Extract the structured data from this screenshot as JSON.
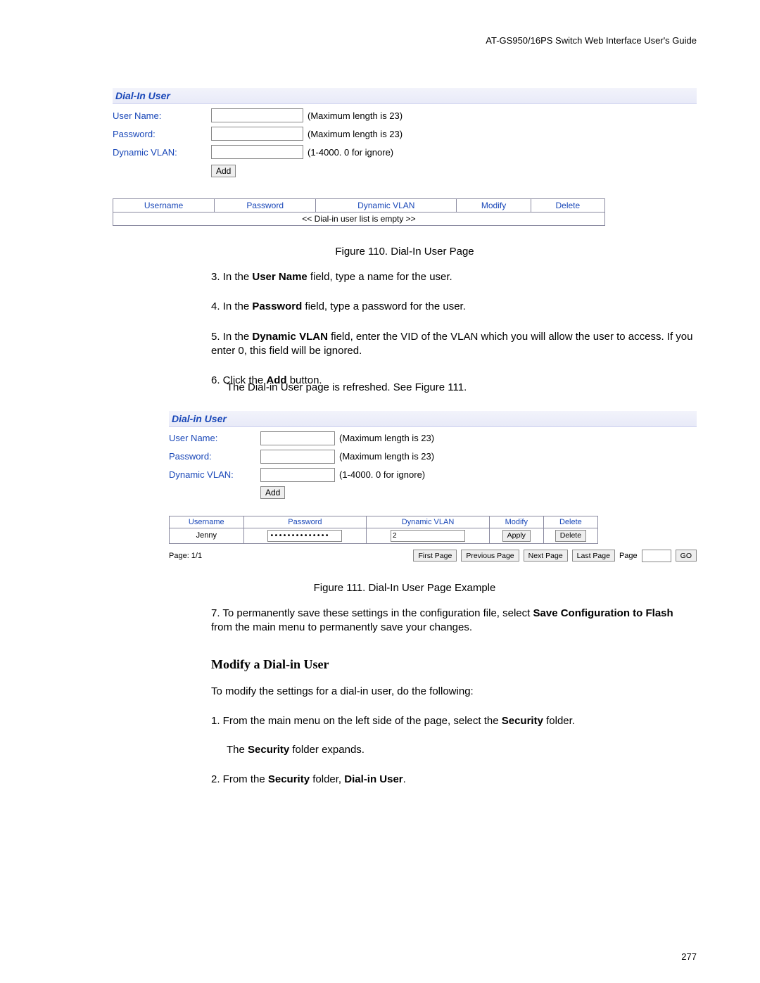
{
  "header": {
    "guide_title": "AT-GS950/16PS Switch Web Interface User's Guide"
  },
  "figure1": {
    "panel_title": "Dial-In User",
    "labels": {
      "username": "User Name:",
      "password": "Password:",
      "vlan": "Dynamic VLAN:"
    },
    "hints": {
      "username": "(Maximum length is 23)",
      "password": "(Maximum length is 23)",
      "vlan": "(1-4000. 0 for ignore)"
    },
    "add_btn": "Add",
    "table": {
      "headers": {
        "username": "Username",
        "password": "Password",
        "vlan": "Dynamic VLAN",
        "modify": "Modify",
        "delete": "Delete"
      },
      "empty_msg": "<< Dial-in user list is empty >>"
    },
    "caption": "Figure 110. Dial-In User Page"
  },
  "instructions_a": {
    "s3_pre": "3.   In the ",
    "s3_bold": "User Name",
    "s3_post": " field, type a name for the user.",
    "s4_pre": "4.   In the ",
    "s4_bold": "Password",
    "s4_post": " field, type a password for the user.",
    "s5_pre": "5.   In the ",
    "s5_bold": "Dynamic VLAN",
    "s5_post": " field, enter the VID of the VLAN which you will allow the user to access. If you enter 0, this field will be ignored.",
    "s6_pre": "6.   Click the ",
    "s6_bold": "Add",
    "s6_post": " button.",
    "s6_line2": "The Dial-in User page is refreshed. See Figure 111."
  },
  "figure2": {
    "panel_title": "Dial-in User",
    "labels": {
      "username": "User Name:",
      "password": "Password:",
      "vlan": "Dynamic VLAN:"
    },
    "hints": {
      "username": "(Maximum length is 23)",
      "password": "(Maximum length is 23)",
      "vlan": "(1-4000. 0 for ignore)"
    },
    "add_btn": "Add",
    "table": {
      "headers": {
        "username": "Username",
        "password": "Password",
        "vlan": "Dynamic VLAN",
        "modify": "Modify",
        "delete": "Delete"
      },
      "row": {
        "username": "Jenny",
        "password": "••••••••••••••",
        "vlan": "2",
        "apply_btn": "Apply",
        "delete_btn": "Delete"
      }
    },
    "pager": {
      "page_label": "Page: 1/1",
      "first": "First Page",
      "prev": "Previous Page",
      "next": "Next Page",
      "last": "Last Page",
      "page_word": "Page",
      "go": "GO"
    },
    "caption": "Figure 111. Dial-In User Page Example"
  },
  "instructions_b": {
    "s7_pre": "7.   To permanently save these settings in the configuration file, select ",
    "s7_bold": "Save Configuration to Flash",
    "s7_post": " from the main menu to permanently save your changes."
  },
  "section_heading": "Modify a Dial-in User",
  "modify_intro": "To modify the settings for a dial-in user, do the following:",
  "modify_steps": {
    "s1_pre": "1.   From the main menu on the left side of the page, select the ",
    "s1_bold": "Security",
    "s1_post": " folder.",
    "s1_line2a": "The ",
    "s1_line2b": "Security",
    "s1_line2c": " folder expands.",
    "s2_pre": "2.   From the ",
    "s2_bold1": "Security",
    "s2_mid": " folder, ",
    "s2_bold2": "Dial-in User",
    "s2_post": "."
  },
  "page_number": "277"
}
